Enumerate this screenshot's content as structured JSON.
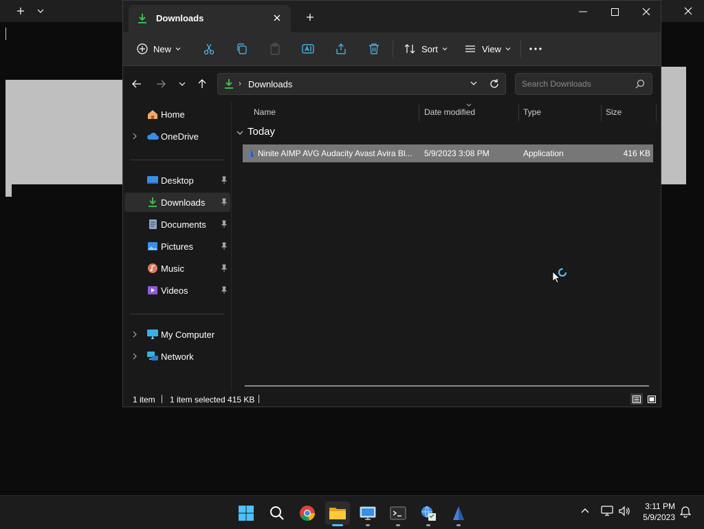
{
  "background": {
    "top_bar": "terminal"
  },
  "window": {
    "tab_title": "Downloads",
    "toolbar": {
      "new_label": "New",
      "sort_label": "Sort",
      "view_label": "View"
    },
    "address": {
      "current_folder": "Downloads",
      "separator": "›",
      "search_placeholder": "Search Downloads"
    },
    "sidebar": {
      "home": "Home",
      "onedrive": "OneDrive",
      "desktop": "Desktop",
      "downloads": "Downloads",
      "documents": "Documents",
      "pictures": "Pictures",
      "music": "Music",
      "videos": "Videos",
      "my_computer": "My Computer",
      "network": "Network"
    },
    "columns": {
      "name": "Name",
      "date_modified": "Date modified",
      "type": "Type",
      "size": "Size"
    },
    "group_label": "Today",
    "file": {
      "name": "Ninite AIMP AVG Audacity Avast Avira Bl...",
      "date": "5/9/2023 3:08 PM",
      "type": "Application",
      "size": "416 KB"
    },
    "status": {
      "count": "1 item",
      "selection": "1 item selected  415 KB"
    }
  },
  "taskbar": {
    "time": "3:11 PM",
    "date": "5/9/2023"
  },
  "colors": {
    "accent": "#4cc2ff",
    "download_green": "#3fb950",
    "selection_row": "#777777"
  }
}
